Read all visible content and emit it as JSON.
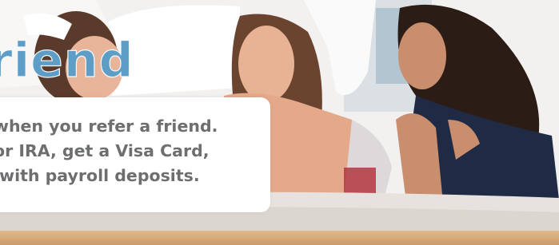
{
  "banner": {
    "headline": "riend",
    "lines": [
      "when you refer a friend.",
      "or IRA, get a Visa Card,",
      " with payroll deposits."
    ],
    "colors": {
      "headline": "#5e9dc6",
      "body_text": "#6d6e70",
      "card": "#ffffff"
    }
  }
}
